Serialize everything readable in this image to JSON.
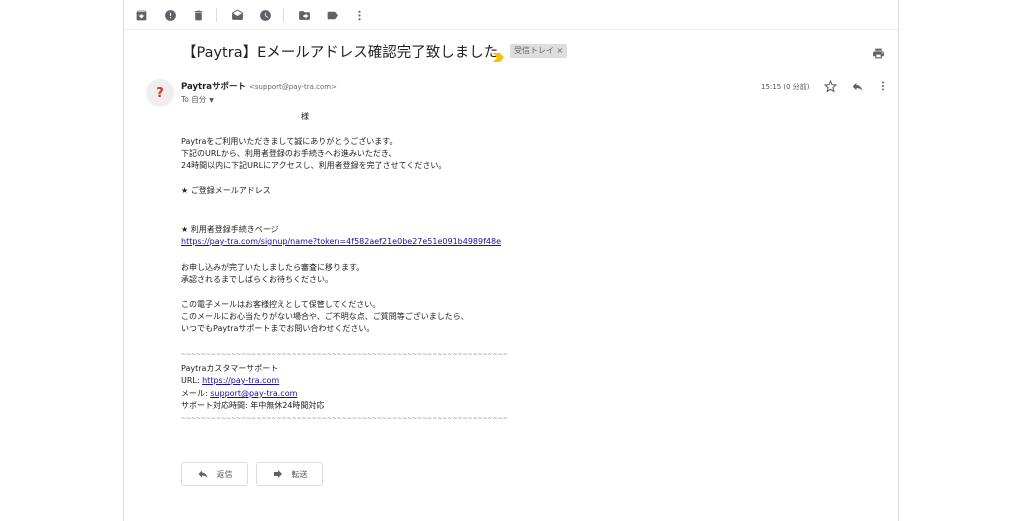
{
  "toolbar": {
    "icons": [
      "archive-icon",
      "report-spam-icon",
      "delete-icon",
      "mark-unread-icon",
      "snooze-icon",
      "move-to-icon",
      "label-icon",
      "more-vert-icon"
    ]
  },
  "message": {
    "subject": "【Paytra】Eメールアドレス確認完了致しました",
    "label": "受信トレイ ×",
    "sender_name": "Paytraサポート",
    "sender_email": "<support@pay-tra.com>",
    "to": "To 自分",
    "time": "15:15 (0 分前)",
    "avatar_letter": "?"
  },
  "body": {
    "salutation": "様",
    "line1": "Paytraをご利用いただきまして誠にありがとうございます。",
    "line2": "下記のURLから、利用者登録のお手続きへお進みいただき、",
    "line3": "24時間以内に下記URLにアクセスし、利用者登録を完了させてください。",
    "email_heading": "★ ご登録メールアドレス",
    "page_heading": "★ 利用者登録手続きページ",
    "signup_link": "https://pay-tra.com/signup/name?token=4f582aef21e0be27e51e091b4989f48e",
    "review1": "お申し込みが完了いたしましたら審査に移ります。",
    "review2": "承認されるまでしばらくお待ちください。",
    "note1": "この電子メールはお客様控えとして保管してください。",
    "note2": "このメールにお心当たりがない場合や、ご不明な点、ご質問等ございましたら、",
    "note3": "いつでもPaytraサポートまでお問い合わせください。",
    "divider": "~~~~~~~~~~~~~~~~~~~~~~~~~~~~~~~~~~~~~~~~~~~~~~~~~~~~~~~~~~~~~~~~~",
    "sig_name": "Paytraカスタマーサポート",
    "sig_url_label": "URL: ",
    "sig_url": "https://pay-tra.com",
    "sig_mail_label": "メール: ",
    "sig_mail": "support@pay-tra.com",
    "sig_hours": "サポート対応時間: 年中無休24時間対応"
  },
  "actions": {
    "reply_label": "返信",
    "forward_label": "転送"
  },
  "colors": {
    "icon_gray": "#5f6368",
    "important_yellow": "#f4c20d",
    "link_blue": "#1a0dab",
    "avatar_red": "#d93025"
  }
}
